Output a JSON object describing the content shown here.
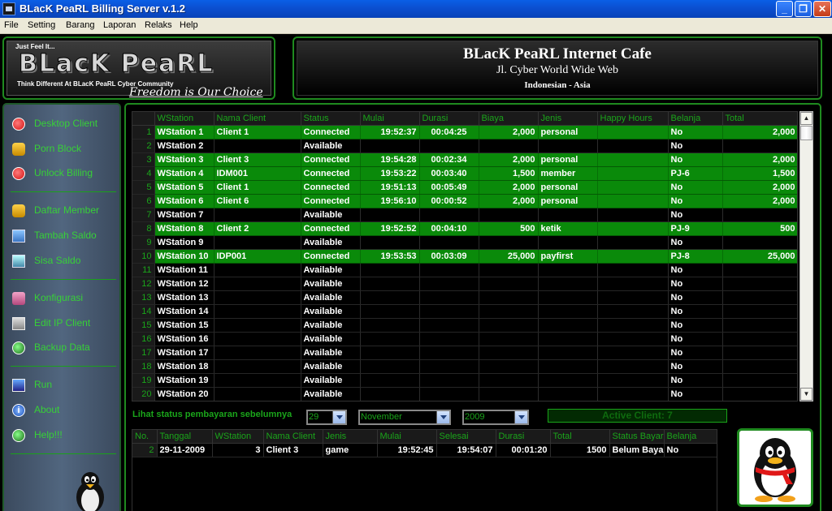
{
  "window": {
    "title": "BLacK PeaRL Billing Server v.1.2",
    "min": "_",
    "max": "❐",
    "close": "✕"
  },
  "menu": [
    "File",
    "Setting",
    "Barang",
    "Laporan",
    "Relaks",
    "Help"
  ],
  "logo": {
    "tagline": "Just Feel It...",
    "brand": "BLacK PeaRL",
    "subtitle": "Think Different At BLacK PeaRL Cyber Community",
    "script": "Freedom is Our Choice"
  },
  "header": {
    "title": "BLacK PeaRL Internet Cafe",
    "address": "Jl. Cyber World Wide Web",
    "region": "Indonesian - Asia"
  },
  "sidebar": [
    {
      "label": "Desktop Client",
      "icon": "desktop-client-icon"
    },
    {
      "label": "Porn Block",
      "icon": "porn-block-icon"
    },
    {
      "label": "Unlock Billing",
      "icon": "unlock-billing-icon"
    },
    {
      "label": "Daftar Member",
      "icon": "daftar-member-icon"
    },
    {
      "label": "Tambah Saldo",
      "icon": "tambah-saldo-icon"
    },
    {
      "label": "Sisa Saldo",
      "icon": "sisa-saldo-icon"
    },
    {
      "label": "Konfigurasi",
      "icon": "konfigurasi-icon"
    },
    {
      "label": "Edit IP Client",
      "icon": "edit-ip-client-icon"
    },
    {
      "label": "Backup Data",
      "icon": "backup-data-icon"
    },
    {
      "label": "Run",
      "icon": "run-icon"
    },
    {
      "label": "About",
      "icon": "about-icon"
    },
    {
      "label": "Help!!!",
      "icon": "help-icon"
    }
  ],
  "grid": {
    "columns": [
      "WStation",
      "Nama Client",
      "Status",
      "Mulai",
      "Durasi",
      "Biaya",
      "Jenis",
      "Happy Hours",
      "Belanja",
      "Total"
    ],
    "rows": [
      [
        "1",
        "WStation 1",
        "Client 1",
        "Connected",
        "19:52:37",
        "00:04:25",
        "2,000",
        "personal",
        "",
        "No",
        "2,000"
      ],
      [
        "2",
        "WStation 2",
        "",
        "Available",
        "",
        "",
        "",
        "",
        "",
        "No",
        ""
      ],
      [
        "3",
        "WStation 3",
        "Client 3",
        "Connected",
        "19:54:28",
        "00:02:34",
        "2,000",
        "personal",
        "",
        "No",
        "2,000"
      ],
      [
        "4",
        "WStation 4",
        "IDM001",
        "Connected",
        "19:53:22",
        "00:03:40",
        "1,500",
        "member",
        "",
        "PJ-6",
        "1,500"
      ],
      [
        "5",
        "WStation 5",
        "Client 1",
        "Connected",
        "19:51:13",
        "00:05:49",
        "2,000",
        "personal",
        "",
        "No",
        "2,000"
      ],
      [
        "6",
        "WStation 6",
        "Client 6",
        "Connected",
        "19:56:10",
        "00:00:52",
        "2,000",
        "personal",
        "",
        "No",
        "2,000"
      ],
      [
        "7",
        "WStation 7",
        "",
        "Available",
        "",
        "",
        "",
        "",
        "",
        "No",
        ""
      ],
      [
        "8",
        "WStation 8",
        "Client 2",
        "Connected",
        "19:52:52",
        "00:04:10",
        "500",
        "ketik",
        "",
        "PJ-9",
        "500"
      ],
      [
        "9",
        "WStation 9",
        "",
        "Available",
        "",
        "",
        "",
        "",
        "",
        "No",
        ""
      ],
      [
        "10",
        "WStation 10",
        "IDP001",
        "Connected",
        "19:53:53",
        "00:03:09",
        "25,000",
        "payfirst",
        "",
        "PJ-8",
        "25,000"
      ],
      [
        "11",
        "WStation 11",
        "",
        "Available",
        "",
        "",
        "",
        "",
        "",
        "No",
        ""
      ],
      [
        "12",
        "WStation 12",
        "",
        "Available",
        "",
        "",
        "",
        "",
        "",
        "No",
        ""
      ],
      [
        "13",
        "WStation 13",
        "",
        "Available",
        "",
        "",
        "",
        "",
        "",
        "No",
        ""
      ],
      [
        "14",
        "WStation 14",
        "",
        "Available",
        "",
        "",
        "",
        "",
        "",
        "No",
        ""
      ],
      [
        "15",
        "WStation 15",
        "",
        "Available",
        "",
        "",
        "",
        "",
        "",
        "No",
        ""
      ],
      [
        "16",
        "WStation 16",
        "",
        "Available",
        "",
        "",
        "",
        "",
        "",
        "No",
        ""
      ],
      [
        "17",
        "WStation 17",
        "",
        "Available",
        "",
        "",
        "",
        "",
        "",
        "No",
        ""
      ],
      [
        "18",
        "WStation 18",
        "",
        "Available",
        "",
        "",
        "",
        "",
        "",
        "No",
        ""
      ],
      [
        "19",
        "WStation 19",
        "",
        "Available",
        "",
        "",
        "",
        "",
        "",
        "No",
        ""
      ],
      [
        "20",
        "WStation 20",
        "",
        "Available",
        "",
        "",
        "",
        "",
        "",
        "No",
        ""
      ]
    ]
  },
  "filter": {
    "label": "Lihat status pembayaran sebelumnya",
    "day": "29",
    "month": "November",
    "year": "2009",
    "active": "Active Client: 7"
  },
  "payments": {
    "columns": [
      "No.",
      "Tanggal",
      "WStation",
      "Nama Client",
      "Jenis",
      "Mulai",
      "Selesai",
      "Durasi",
      "Total",
      "Status Bayar",
      "Belanja"
    ],
    "rows": [
      [
        "2",
        "29-11-2009",
        "3",
        "Client 3",
        "game",
        "19:52:45",
        "19:54:07",
        "00:01:20",
        "1500",
        "Belum Bayar",
        "No"
      ]
    ]
  },
  "colors": {
    "accent": "#0a8a0a",
    "label_green": "#1aa51a",
    "menu_green": "#37d137",
    "titlebar": "#0b4fd0"
  }
}
